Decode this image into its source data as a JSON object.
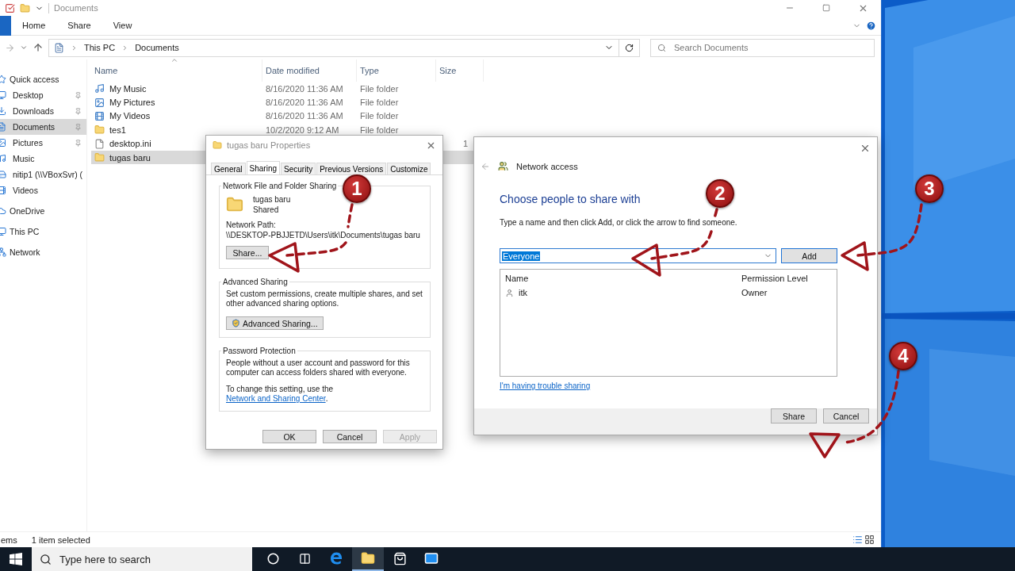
{
  "explorer": {
    "title": "Documents",
    "ribbon_tabs": [
      {
        "label": "Home"
      },
      {
        "label": "Share"
      },
      {
        "label": "View"
      }
    ],
    "breadcrumb": [
      "This PC",
      "Documents"
    ],
    "search": {
      "placeholder": "Search Documents"
    },
    "nav": [
      {
        "label": "Quick access",
        "kind": "star",
        "selected": false,
        "children": [
          {
            "label": "Desktop",
            "kind": "desktop",
            "pinned": true,
            "selected": false
          },
          {
            "label": "Downloads",
            "kind": "download",
            "pinned": true,
            "selected": false
          },
          {
            "label": "Documents",
            "kind": "documents",
            "pinned": true,
            "selected": true
          },
          {
            "label": "Pictures",
            "kind": "pictures",
            "pinned": true,
            "selected": false
          },
          {
            "label": "Music",
            "kind": "music",
            "pinned": false,
            "selected": false
          },
          {
            "label": "nitip1 (\\\\VBoxSvr) (",
            "kind": "drive",
            "pinned": false,
            "selected": false
          },
          {
            "label": "Videos",
            "kind": "videos",
            "pinned": false,
            "selected": false
          }
        ]
      },
      {
        "label": "OneDrive",
        "kind": "cloud",
        "selected": false
      },
      {
        "label": "This PC",
        "kind": "pc",
        "selected": false
      },
      {
        "label": "Network",
        "kind": "network",
        "selected": false
      }
    ],
    "columns": [
      "Name",
      "Date modified",
      "Type",
      "Size"
    ],
    "rows": [
      {
        "name": "My Music",
        "kind": "music",
        "date": "8/16/2020 11:36 AM",
        "type": "File folder",
        "selected": false
      },
      {
        "name": "My Pictures",
        "kind": "pictures",
        "date": "8/16/2020 11:36 AM",
        "type": "File folder",
        "selected": false
      },
      {
        "name": "My Videos",
        "kind": "videos",
        "date": "8/16/2020 11:36 AM",
        "type": "File folder",
        "selected": false
      },
      {
        "name": "tes1",
        "kind": "folder",
        "date": "10/2/2020 9:12 AM",
        "type": "File folder",
        "selected": false
      },
      {
        "name": "desktop.ini",
        "kind": "file",
        "size": "1",
        "selected": false
      },
      {
        "name": "tugas baru",
        "kind": "folder",
        "selected": true
      }
    ],
    "status": [
      "ems",
      "1 item selected"
    ]
  },
  "properties_dialog": {
    "title": "tugas baru Properties",
    "tabs": [
      {
        "label": "General",
        "selected": false
      },
      {
        "label": "Sharing",
        "selected": true
      },
      {
        "label": "Security",
        "selected": false
      },
      {
        "label": "Previous Versions",
        "selected": false
      },
      {
        "label": "Customize",
        "selected": false
      }
    ],
    "network_sharing": {
      "legend": "Network File and Folder Sharing",
      "folder_name": "tugas baru",
      "folder_state": "Shared",
      "path_label": "Network Path:",
      "path": "\\\\DESKTOP-PBJJETD\\Users\\itk\\Documents\\tugas baru",
      "button": "Share..."
    },
    "advanced_sharing": {
      "legend": "Advanced Sharing",
      "text": "Set custom permissions, create multiple shares, and set other advanced sharing options.",
      "button": "Advanced Sharing..."
    },
    "password_protection": {
      "legend": "Password Protection",
      "text": "People without a user account and password for this computer can access folders shared with everyone.",
      "change_before": "To change this setting, use the ",
      "link": "Network and Sharing Center",
      "change_after": "."
    },
    "buttons": [
      {
        "label": "OK",
        "disabled": false
      },
      {
        "label": "Cancel",
        "disabled": false
      },
      {
        "label": "Apply",
        "disabled": true
      }
    ]
  },
  "network_dialog": {
    "title": "Network access",
    "heading": "Choose people to share with",
    "instruction": "Type a name and then click Add, or click the arrow to find someone.",
    "combo": {
      "value": "Everyone",
      "value_selected": true
    },
    "add_button": "Add",
    "columns": [
      "Name",
      "Permission Level"
    ],
    "rows": [
      {
        "name": "itk",
        "permission": "Owner"
      }
    ],
    "help_link": "I'm having trouble sharing",
    "buttons": [
      "Share",
      "Cancel"
    ]
  },
  "annotations": [
    {
      "number": "1"
    },
    {
      "number": "2"
    },
    {
      "number": "3"
    },
    {
      "number": "4"
    }
  ],
  "taskbar": {
    "search_placeholder": "Type here to search",
    "apps": [
      {
        "kind": "cortana",
        "active": false
      },
      {
        "kind": "taskview",
        "active": false
      },
      {
        "kind": "edge",
        "active": false
      },
      {
        "kind": "explorer",
        "active": true
      },
      {
        "kind": "store",
        "active": false
      },
      {
        "kind": "mail",
        "active": false
      }
    ]
  }
}
